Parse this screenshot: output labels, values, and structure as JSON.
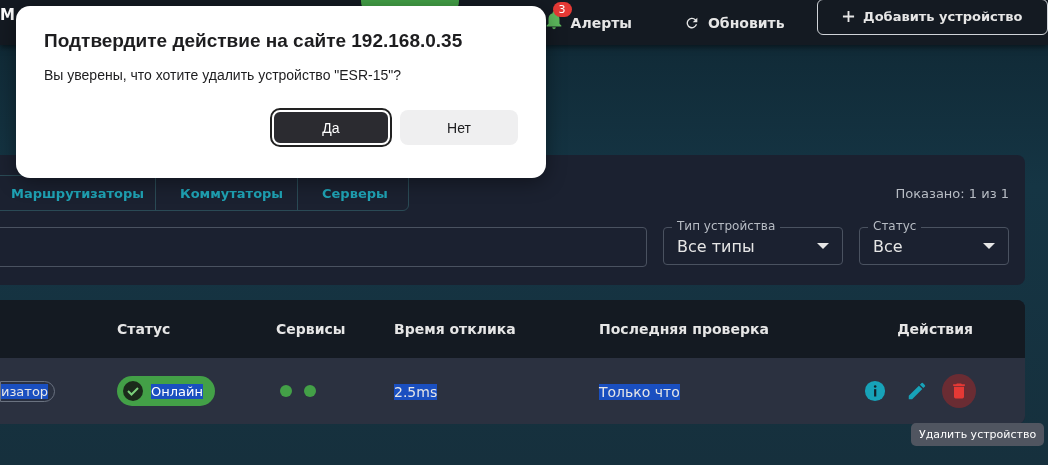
{
  "header": {
    "brand": "М",
    "alerts": {
      "badge": "3",
      "label": "Алерты"
    },
    "refresh": "Обновить",
    "add_device": "Добавить устройство"
  },
  "filters": {
    "tabs": [
      {
        "label": "Маршрутизаторы"
      },
      {
        "label": "Коммутаторы"
      },
      {
        "label": "Серверы"
      }
    ],
    "shown": "Показано: 1 из 1",
    "device_type": {
      "label": "Тип устройства",
      "value": "Все типы"
    },
    "status": {
      "label": "Статус",
      "value": "Все"
    }
  },
  "table": {
    "columns": [
      "Статус",
      "Сервисы",
      "Время отклика",
      "Последняя проверка",
      "Действия"
    ],
    "rows": [
      {
        "type": "изатор",
        "status": "Онлайн",
        "online": true,
        "services": [
          {
            "color": "#43a047"
          },
          {
            "color": "#43a047"
          }
        ],
        "response": "2.5ms",
        "checked": "Только что",
        "highlighted": true
      }
    ]
  },
  "tooltip": "Удалить устройство",
  "dialog": {
    "title": "Подтвердите действие на сайте 192.168.0.35",
    "message": "Вы уверены, что хотите удалить устройство \"ESR-15\"?",
    "buttons": [
      {
        "label": "Да",
        "kind": "primary"
      },
      {
        "label": "Нет",
        "kind": "secondary"
      }
    ]
  }
}
